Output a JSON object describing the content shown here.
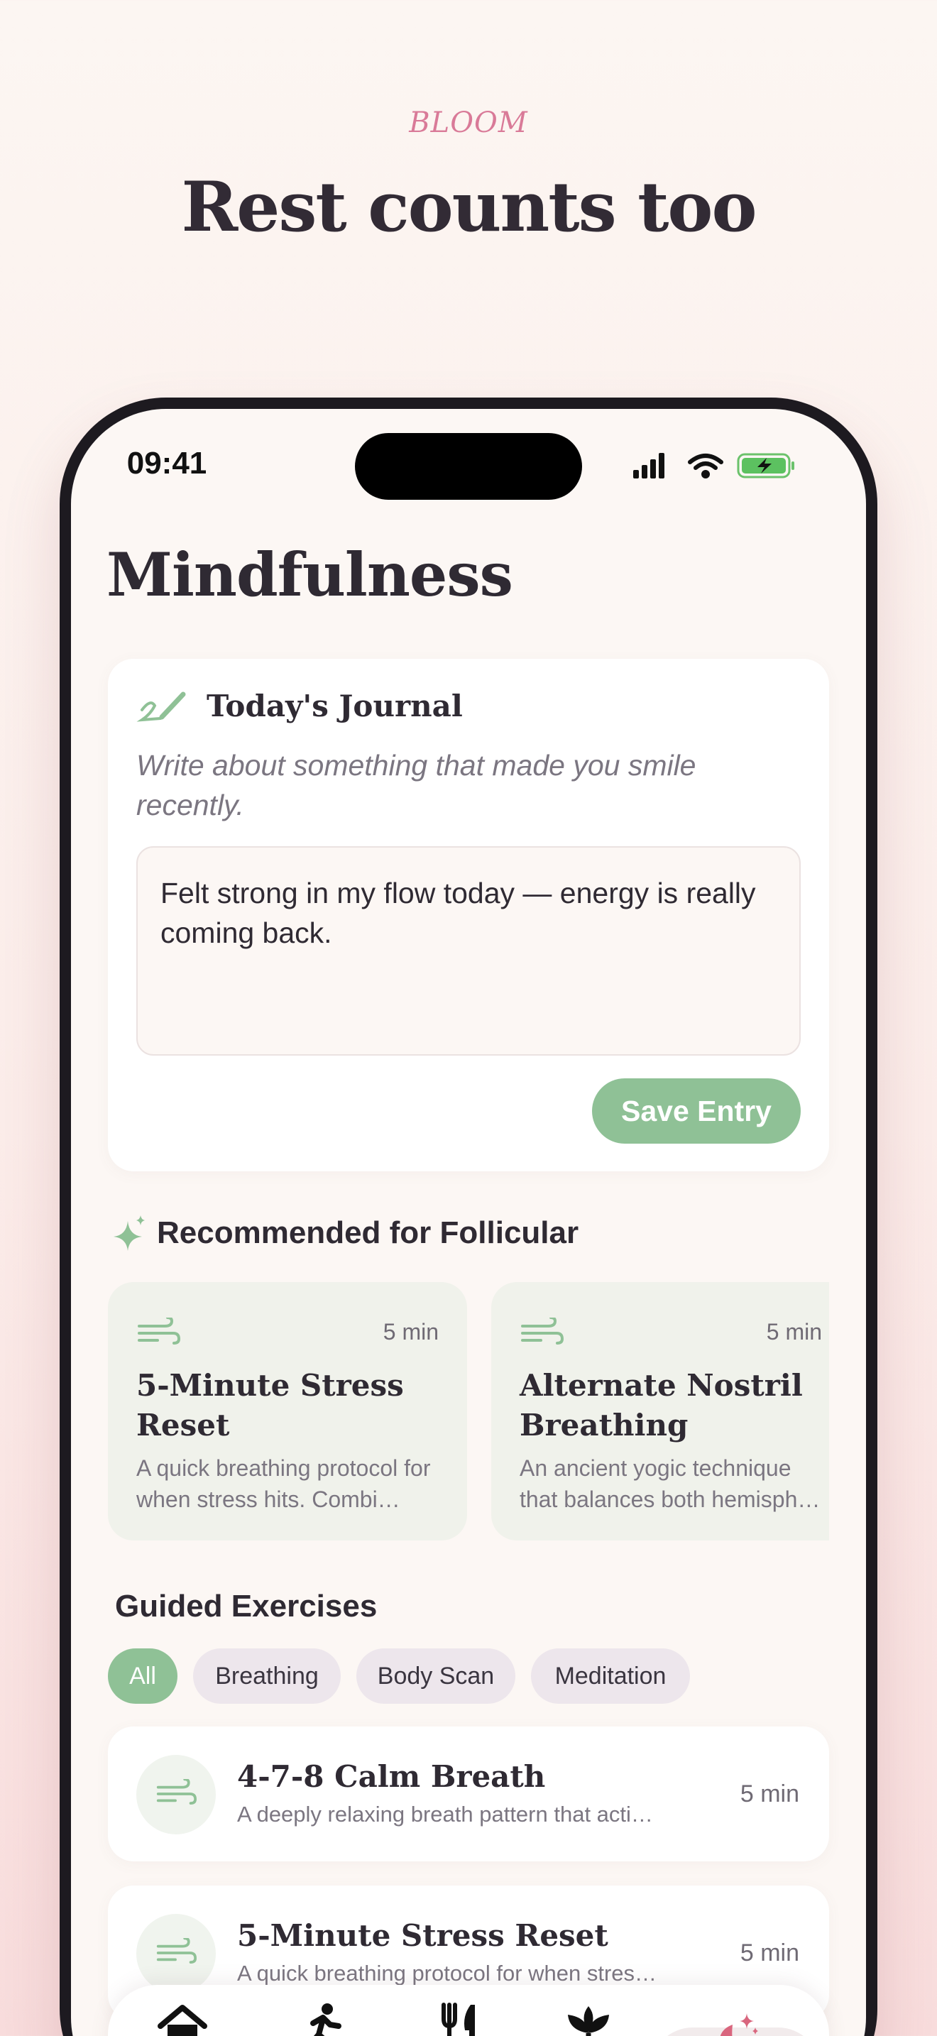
{
  "hero": {
    "brand": "BLOOM",
    "title": "Rest counts too"
  },
  "status_bar": {
    "time": "09:41",
    "icons": [
      "signal-icon",
      "wifi-icon",
      "battery-charging-icon"
    ]
  },
  "page": {
    "title": "Mindfulness"
  },
  "journal": {
    "icon": "pen-icon",
    "title": "Today's Journal",
    "prompt": "Write about something that made you smile recently.",
    "entry_value": "Felt strong in my flow today — energy is really coming back.",
    "save_label": "Save Entry"
  },
  "recommended": {
    "icon": "sparkle-icon",
    "title": "Recommended for Follicular",
    "items": [
      {
        "icon": "wind-icon",
        "duration": "5 min",
        "name": "5-Minute Stress Reset",
        "desc": "A quick breathing protocol for when stress hits. Combi…"
      },
      {
        "icon": "wind-icon",
        "duration": "5 min",
        "name": "Alternate Nostril Breathing",
        "desc": "An ancient yogic technique that balances both hemisph…"
      }
    ]
  },
  "guided": {
    "title": "Guided Exercises",
    "filters": [
      "All",
      "Breathing",
      "Body Scan",
      "Meditation"
    ],
    "active_filter": "All",
    "exercises": [
      {
        "icon": "wind-icon",
        "name": "4-7-8 Calm Breath",
        "desc": "A deeply relaxing breath pattern that acti…",
        "duration": "5 min"
      },
      {
        "icon": "wind-icon",
        "name": "5-Minute Stress Reset",
        "desc": "A quick breathing protocol for when stres…",
        "duration": "5 min"
      }
    ]
  },
  "tabbar": {
    "tabs": [
      "home-icon",
      "running-icon",
      "fork-knife-icon",
      "lotus-icon",
      "moon-sparkle-icon"
    ],
    "active_tab": "moon-sparkle-icon",
    "accent": "#d9667e"
  },
  "colors": {
    "accent_green": "#8fc196",
    "brand_pink": "#d97a98",
    "text_dark": "#2f2a33"
  }
}
